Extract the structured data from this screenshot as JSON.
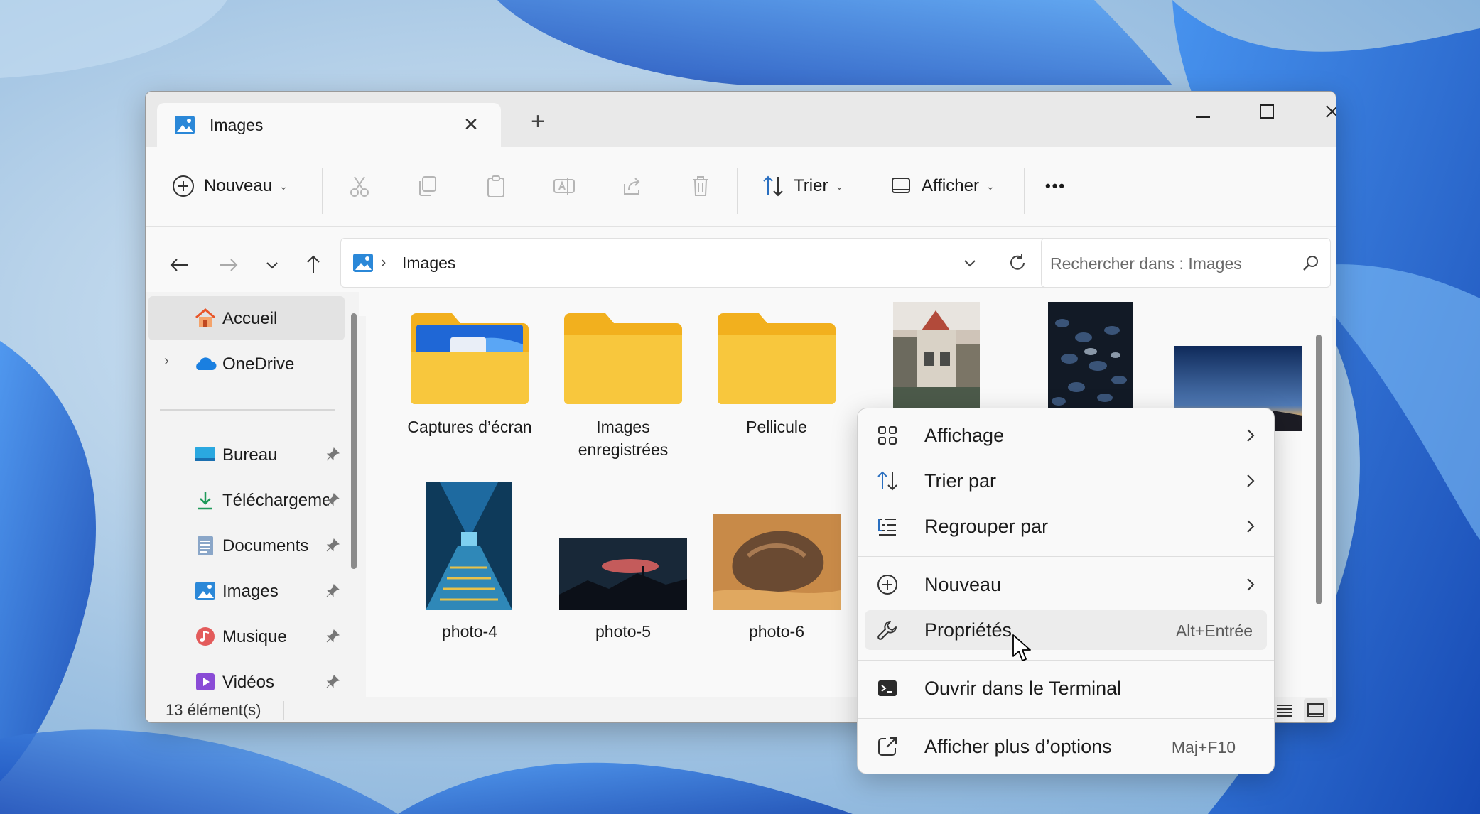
{
  "window": {
    "tab_title": "Images",
    "new_tab": "+"
  },
  "toolbar": {
    "new_label": "Nouveau",
    "sort_label": "Trier",
    "view_label": "Afficher",
    "more_label": "•••"
  },
  "address": {
    "path": "Images",
    "search_placeholder": "Rechercher dans : Images"
  },
  "sidebar": {
    "items": [
      {
        "label": "Accueil",
        "icon": "home-icon"
      },
      {
        "label": "OneDrive",
        "icon": "cloud-icon"
      },
      {
        "label": "Bureau",
        "icon": "desktop-icon"
      },
      {
        "label": "Téléchargements",
        "icon": "download-icon"
      },
      {
        "label": "Documents",
        "icon": "document-icon"
      },
      {
        "label": "Images",
        "icon": "image-icon"
      },
      {
        "label": "Musique",
        "icon": "music-icon"
      },
      {
        "label": "Vidéos",
        "icon": "video-icon"
      }
    ]
  },
  "content": {
    "items": [
      {
        "name": "Captures d’écran",
        "type": "folder"
      },
      {
        "name": "Images enregistrées",
        "type": "folder"
      },
      {
        "name": "Pellicule",
        "type": "folder"
      },
      {
        "name": "",
        "type": "photo"
      },
      {
        "name": "",
        "type": "photo"
      },
      {
        "name": "",
        "type": "photo"
      },
      {
        "name": "photo-4",
        "type": "photo"
      },
      {
        "name": "photo-5",
        "type": "photo"
      },
      {
        "name": "photo-6",
        "type": "photo"
      }
    ]
  },
  "status": {
    "count": "13 élément(s)"
  },
  "context_menu": {
    "items": [
      {
        "label": "Affichage",
        "icon": "grid-icon",
        "submenu": true
      },
      {
        "label": "Trier par",
        "icon": "sort-icon",
        "submenu": true
      },
      {
        "label": "Regrouper par",
        "icon": "list-icon",
        "submenu": true
      },
      {
        "label": "Nouveau",
        "icon": "plus-circle-icon",
        "submenu": true
      },
      {
        "label": "Propriétés",
        "icon": "wrench-icon",
        "shortcut": "Alt+Entrée"
      },
      {
        "label": "Ouvrir dans le Terminal",
        "icon": "terminal-icon"
      },
      {
        "label": "Afficher plus d’options",
        "icon": "external-icon",
        "shortcut": "Maj+F10"
      }
    ]
  },
  "colors": {
    "accent": "#0067c0",
    "folder": "#f8c73d",
    "wallpaper_blue": "#1e5fd0"
  }
}
